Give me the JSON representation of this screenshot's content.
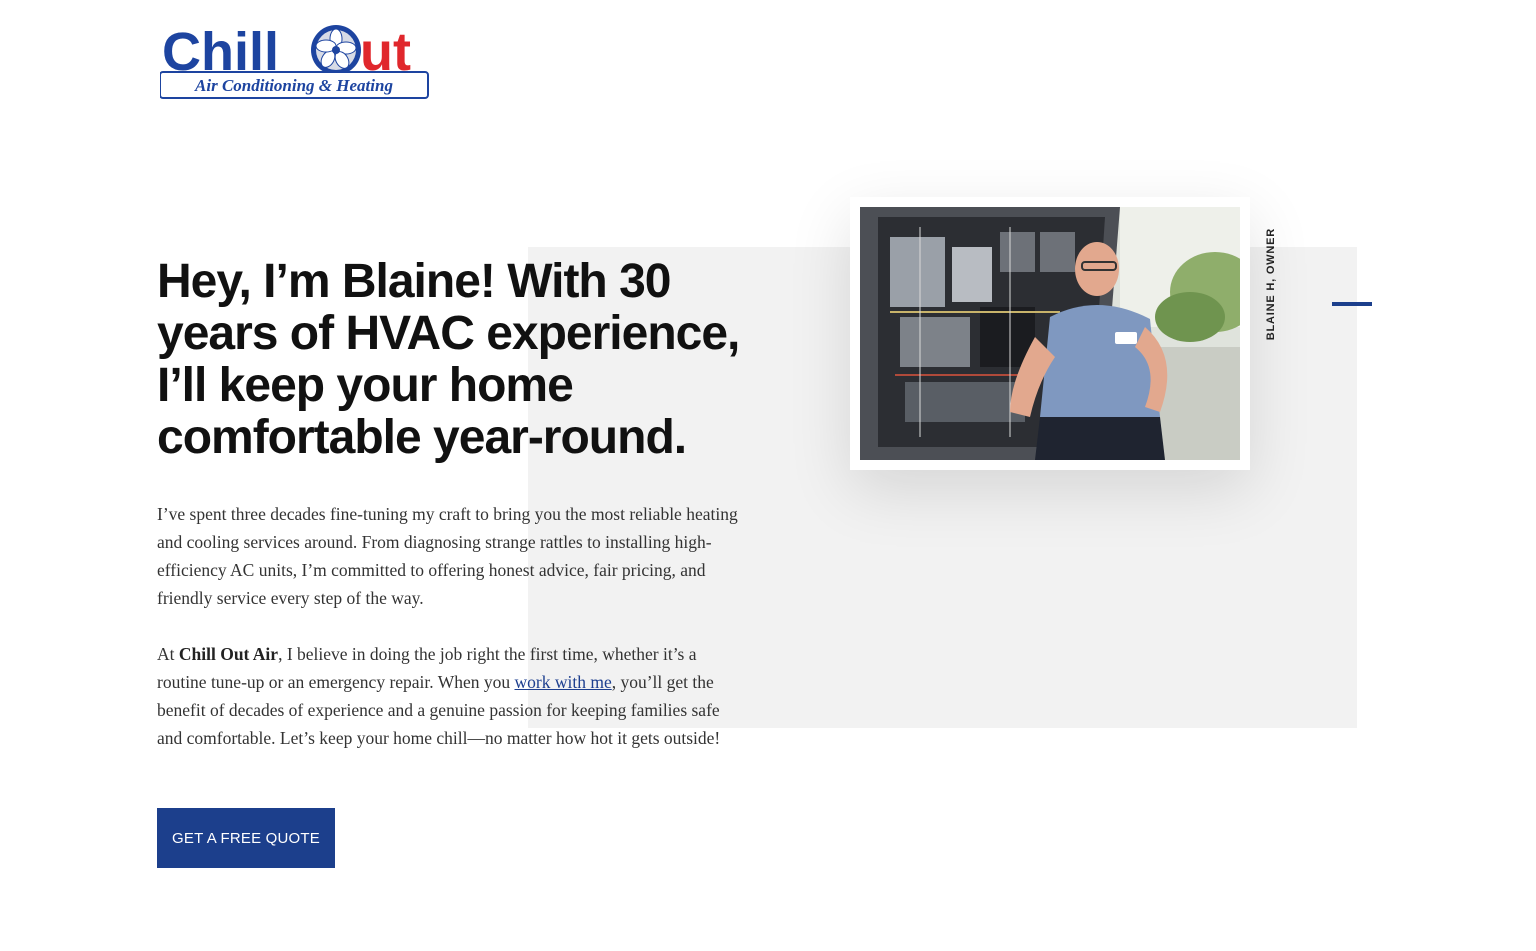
{
  "logo": {
    "word1": "Chill",
    "word2": "Out",
    "tagline": "Air Conditioning & Heating"
  },
  "hero": {
    "headline": "Hey, I’m Blaine! With 30 years of HVAC experience, I’ll keep your home comfortable year-round.",
    "paragraph1": "I’ve spent three decades fine-tuning my craft to bring you the most reliable heating and cooling services around. From diagnosing strange rattles to installing high-efficiency AC units, I’m committed to offering honest advice, fair pricing, and friendly service every step of the way.",
    "paragraph2": {
      "lead": "At ",
      "brand": "Chill Out Air",
      "middle": ", I believe in doing the job right the first time, whether it’s a routine tune-up or an emergency repair. When you ",
      "link": "work with me",
      "tail": ", you’ll get the benefit of decades of experience and a genuine passion for keeping families safe and comfortable. Let’s keep your home chill—no matter how hot it gets outside!"
    },
    "cta_label": "GET A FREE QUOTE"
  },
  "photo": {
    "caption": "BLAINE H, OWNER"
  },
  "colors": {
    "brand_blue": "#1c3f8c",
    "logo_red": "#e0272c",
    "panel_grey": "#f2f2f2",
    "heading": "#111111"
  },
  "icons": [
    "fan-icon"
  ]
}
